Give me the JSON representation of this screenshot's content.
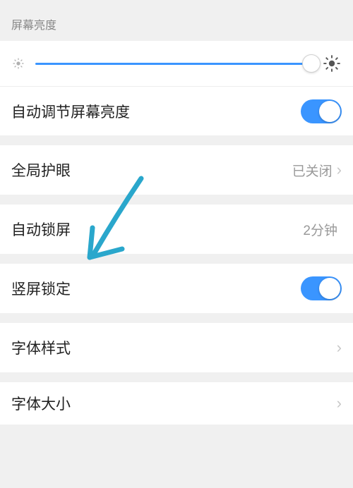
{
  "brightness": {
    "section_title": "屏幕亮度",
    "auto_label": "自动调节屏幕亮度",
    "auto_enabled": true,
    "slider_percent": 100
  },
  "eye_protect": {
    "label": "全局护眼",
    "value": "已关闭"
  },
  "auto_lock": {
    "label": "自动锁屏",
    "value": "2分钟"
  },
  "orientation_lock": {
    "label": "竖屏锁定",
    "enabled": true
  },
  "font_style": {
    "label": "字体样式"
  },
  "font_size": {
    "label": "字体大小"
  },
  "colors": {
    "accent": "#3a95ff",
    "annotation": "#2aa7cc"
  }
}
